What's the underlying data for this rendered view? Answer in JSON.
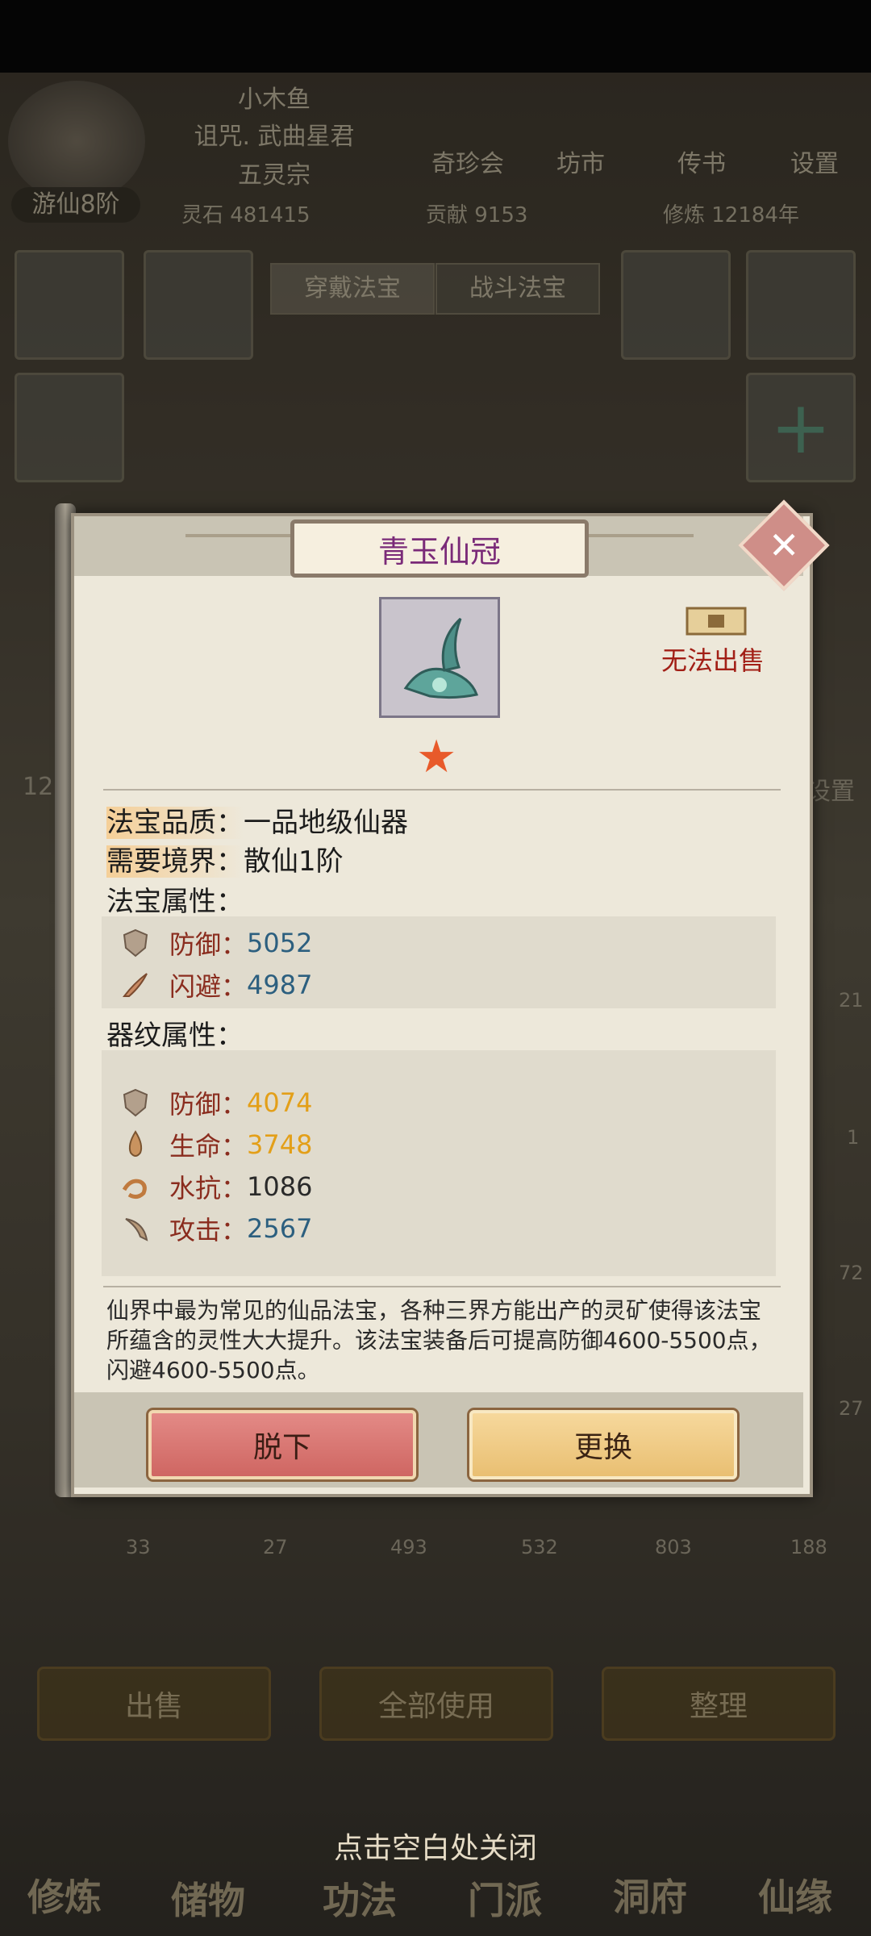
{
  "header": {
    "player_name": "小木鱼",
    "title": "诅咒. 武曲星君",
    "sect": "五灵宗",
    "rank": "游仙8阶",
    "nav": [
      "奇珍会",
      "坊市",
      "传书",
      "设置"
    ],
    "resources": {
      "spirit_stone": "灵石 481415",
      "contribution": "贡献 9153",
      "cultivation": "修炼 12184年"
    }
  },
  "equip_tabs": [
    "穿戴法宝",
    "战斗法宝"
  ],
  "inventory": {
    "counts": [
      "33",
      "27",
      "493",
      "532",
      "803",
      "188"
    ],
    "side_label": "设置",
    "side_count": "12",
    "edge_numbers": [
      "21",
      "1",
      "72",
      "27"
    ],
    "buttons": [
      "出售",
      "全部使用",
      "整理"
    ]
  },
  "bottom_nav": [
    "修炼",
    "储物",
    "功法",
    "门派",
    "洞府",
    "仙缘"
  ],
  "close_hint": "点击空白处关闭",
  "modal": {
    "title": "青玉仙冠",
    "stars": "★",
    "sell_status": "无法出售",
    "quality_label": "法宝品质：",
    "quality_value": "一品地级仙器",
    "realm_label": "需要境界：",
    "realm_value": "散仙1阶",
    "base_attr_title": "法宝属性：",
    "base_attrs": [
      {
        "name": "防御：",
        "value": "5052",
        "icon": "shield-icon"
      },
      {
        "name": "闪避：",
        "value": "4987",
        "icon": "dodge-icon"
      }
    ],
    "pattern_attr_title": "器纹属性：",
    "pattern_attrs": [
      {
        "name": "防御：",
        "value": "4074",
        "icon": "shield-icon"
      },
      {
        "name": "生命：",
        "value": "3748",
        "icon": "life-icon"
      },
      {
        "name": "水抗：",
        "value": "1086",
        "icon": "water-icon"
      },
      {
        "name": "攻击：",
        "value": "2567",
        "icon": "attack-icon"
      }
    ],
    "description": "仙界中最为常见的仙品法宝，各种三界方能出产的灵矿使得该法宝所蕴含的灵性大大提升。该法宝装备后可提高防御4600-5500点，闪避4600-5500点。",
    "remove_label": "脱下",
    "replace_label": "更换"
  },
  "colors": {
    "title": "#7a2a78",
    "blue_value": "#2c5f7f",
    "gold_value": "#e39f18",
    "attr_name": "#8a2c1e",
    "no_sell": "#a21f16"
  }
}
